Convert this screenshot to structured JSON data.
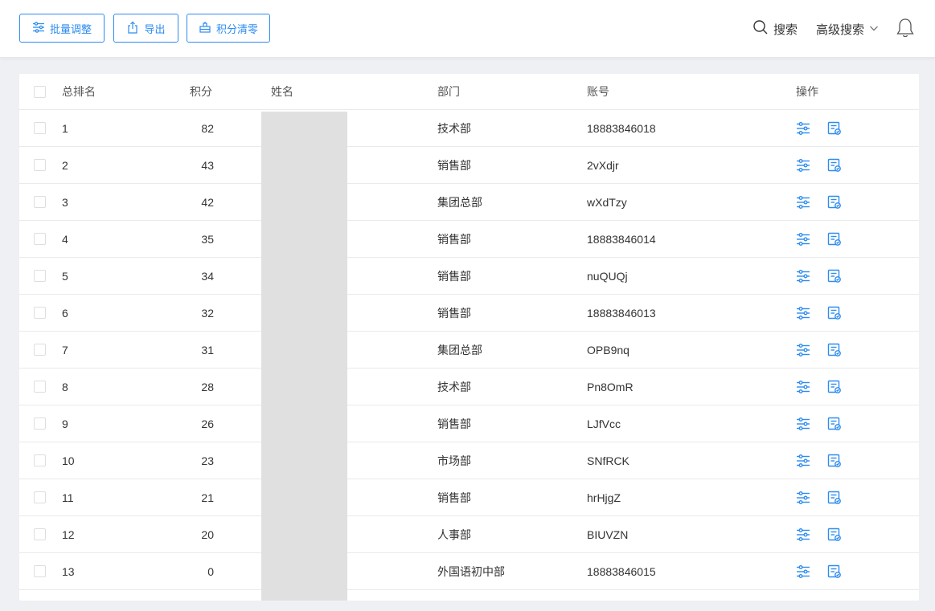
{
  "toolbar": {
    "batch_adjust": "批量调整",
    "export": "导出",
    "clear_points": "积分清零",
    "search": "搜索",
    "advanced_search": "高级搜索"
  },
  "colors": {
    "accent": "#2d8cf0",
    "mask": "#e0e0e0"
  },
  "table": {
    "columns": [
      "总排名",
      "积分",
      "姓名",
      "部门",
      "账号",
      "操作"
    ],
    "rows": [
      {
        "rank": "1",
        "score": "82",
        "dept": "技术部",
        "account": "18883846018"
      },
      {
        "rank": "2",
        "score": "43",
        "dept": "销售部",
        "account": "2vXdjr"
      },
      {
        "rank": "3",
        "score": "42",
        "dept": "集团总部",
        "account": "wXdTzy"
      },
      {
        "rank": "4",
        "score": "35",
        "dept": "销售部",
        "account": "18883846014"
      },
      {
        "rank": "5",
        "score": "34",
        "dept": "销售部",
        "account": "nuQUQj"
      },
      {
        "rank": "6",
        "score": "32",
        "dept": "销售部",
        "account": "18883846013"
      },
      {
        "rank": "7",
        "score": "31",
        "dept": "集团总部",
        "account": "OPB9nq"
      },
      {
        "rank": "8",
        "score": "28",
        "dept": "技术部",
        "account": "Pn8OmR"
      },
      {
        "rank": "9",
        "score": "26",
        "dept": "销售部",
        "account": "LJfVcc"
      },
      {
        "rank": "10",
        "score": "23",
        "dept": "市场部",
        "account": "SNfRCK"
      },
      {
        "rank": "11",
        "score": "21",
        "dept": "销售部",
        "account": "hrHjgZ"
      },
      {
        "rank": "12",
        "score": "20",
        "dept": "人事部",
        "account": "BIUVZN"
      },
      {
        "rank": "13",
        "score": "0",
        "dept": "外国语初中部",
        "account": "18883846015"
      }
    ]
  }
}
